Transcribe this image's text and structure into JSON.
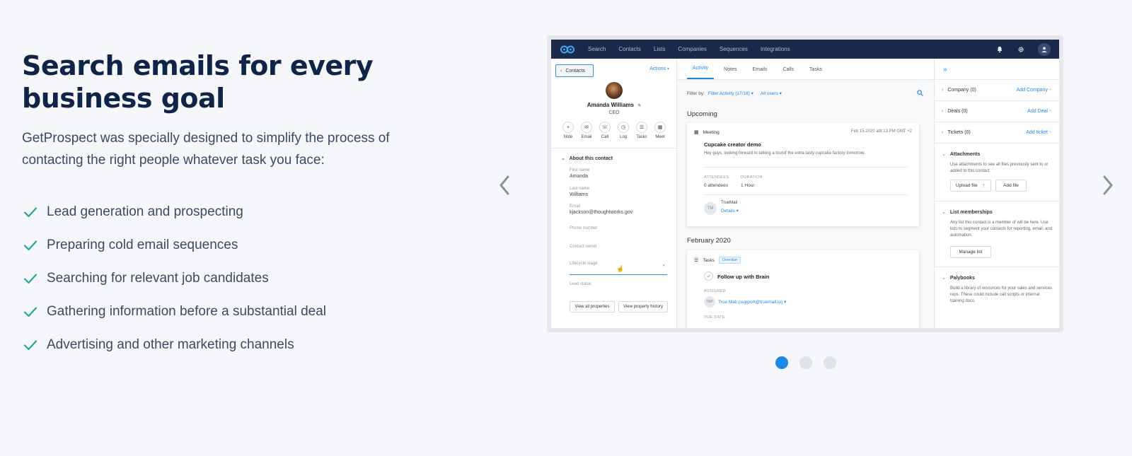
{
  "hero": {
    "headline": "Search emails for every business goal",
    "intro": "GetProspect was specially designed to simplify the process of contacting the right people whatever task you face:",
    "goals": [
      "Lead generation and prospecting",
      "Preparing cold email sequences",
      "Searching for relevant job candidates",
      "Gathering information before a substantial deal",
      "Advertising and other marketing channels"
    ],
    "accent_color": "#1e88e5",
    "check_color": "#26a69a"
  },
  "carousel": {
    "slide_count": 3,
    "active_index": 0
  },
  "app": {
    "nav": [
      "Search",
      "Contacts",
      "Lists",
      "Companies",
      "Sequences",
      "Integrations"
    ],
    "contact": {
      "back_label": "Contacts",
      "actions_label": "Actions",
      "name": "Amanda Williams",
      "role": "CEO",
      "quick_actions": [
        "Note",
        "Email",
        "Call",
        "Log",
        "Tasks",
        "Meet"
      ],
      "about_title": "About this contact",
      "fields": {
        "first_name_label": "First name",
        "first_name": "Amanda",
        "last_name_label": "Last name",
        "last_name": "Williams",
        "email_label": "Email",
        "email": "kjackson@thoughtworks.gov",
        "phone_label": "Phone number",
        "owner_label": "Contact owner",
        "lifecycle_label": "Lifecycle stage",
        "lead_status_label": "Lead status"
      },
      "view_all_label": "View all properties",
      "view_history_label": "View property history"
    },
    "activity": {
      "tabs": [
        "Activity",
        "Notes",
        "Emails",
        "Calls",
        "Tasks"
      ],
      "filter_label": "Filter by:",
      "filter_value": "Filter Activity (17/18)",
      "users_value": "All users",
      "upcoming_heading": "Upcoming",
      "meeting": {
        "type": "Meeting",
        "date": "Feb 15.2020 at8:13 PM GMT +2",
        "title": "Cupcake creator demo",
        "description": "Hey guys, looking forward to talking a tourof the extra tasty cupcake factory tomorrow.",
        "attendees_label": "ATTENDEES",
        "attendees_value": "0 attendees",
        "duration_label": "DURATION",
        "duration_value": "1 Hour",
        "owner_initials": "TM",
        "owner_name": "TrueMail",
        "details_label": "Details"
      },
      "month_heading": "February 2020",
      "task": {
        "type": "Tasks",
        "badge": "Overdue",
        "title": "Follow up with Brain",
        "assigned_label": "ASSIGNED",
        "assignee_initials": "TAP",
        "assignee": "True Mail (support@truemail.io)",
        "due_label": "DUE DATE"
      }
    },
    "sidebar": {
      "company_label": "Company (0)",
      "company_add": "Add Company",
      "deals_label": "Deals (0)",
      "deals_add": "Add Deal",
      "tickets_label": "Tickets (0)",
      "tickets_add": "Add ticket",
      "attachments_title": "Attachments",
      "attachments_text": "Use attachments to see all files previously sent to or added to this contact",
      "upload_label": "Upload file",
      "add_file_label": "Add file",
      "lists_title": "List memberships",
      "lists_text": "Any list this contact is a member of will be here. Use lists to segment your contacts for reporting, email, and automation.",
      "manage_list_label": "Manage list",
      "playbooks_title": "Palybooks",
      "playbooks_text": "Build a library of resources for your sales and services reps. These could include call scripts or internal training docs."
    }
  }
}
